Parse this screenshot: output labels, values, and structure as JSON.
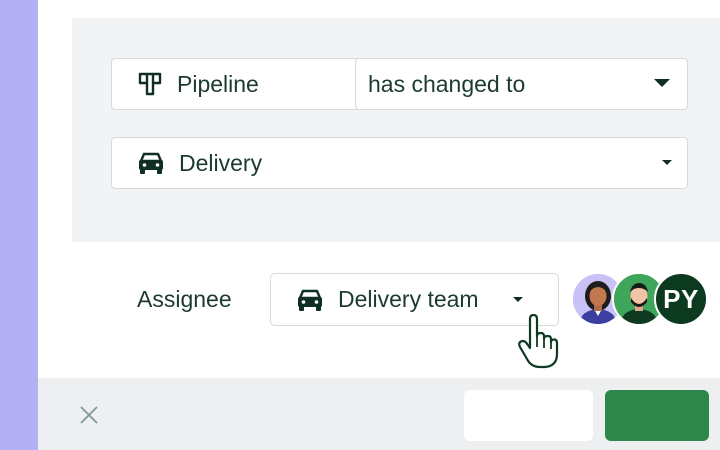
{
  "condition": {
    "field_label": "Pipeline",
    "field_icon": "pipeline-icon",
    "operator_label": "has changed to",
    "value_label": "Delivery",
    "value_icon": "car-icon"
  },
  "assignee": {
    "label": "Assignee",
    "team_label": "Delivery team",
    "team_icon": "car-icon",
    "avatars": [
      {
        "kind": "photo",
        "icon": "woman-avatar-icon"
      },
      {
        "kind": "photo",
        "icon": "man-avatar-icon"
      },
      {
        "kind": "initials",
        "initials": "PY"
      }
    ]
  },
  "footer": {
    "close_icon": "close-icon",
    "cancel_label": "",
    "confirm_label": ""
  },
  "colors": {
    "rail": "#b3b0f3",
    "panel": "#f2f3f5",
    "text": "#1c3b30",
    "confirm": "#2d874b",
    "initials_avatar": "#0c3a1e"
  }
}
